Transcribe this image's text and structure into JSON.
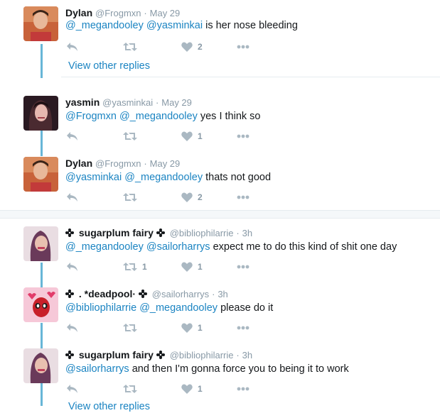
{
  "thread1": {
    "tweets": [
      {
        "name": "Dylan",
        "handle": "@Frogmxn",
        "dot": "·",
        "time": "May 29",
        "mentions": [
          "@_megandooley",
          "@yasminkai"
        ],
        "text": "is her nose bleeding",
        "likes": "2",
        "retweets": ""
      },
      {
        "name": "yasmin",
        "handle": "@yasminkai",
        "dot": "·",
        "time": "May 29",
        "mentions": [
          "@Frogmxn",
          "@_megandooley"
        ],
        "text": "yes I think so",
        "likes": "1",
        "retweets": ""
      },
      {
        "name": "Dylan",
        "handle": "@Frogmxn",
        "dot": "·",
        "time": "May 29",
        "mentions": [
          "@yasminkai",
          "@_megandooley"
        ],
        "text": "thats not good",
        "likes": "2",
        "retweets": ""
      }
    ],
    "view_other_replies": "View other replies"
  },
  "thread2": {
    "tweets": [
      {
        "name": "sugarplum fairy",
        "handle": "@bibliophilarrie",
        "dot": "·",
        "time": "3h",
        "mentions": [
          "@_megandooley",
          "@sailorharrys"
        ],
        "text": "expect me to do this kind of shit one day",
        "likes": "1",
        "retweets": "1"
      },
      {
        "name": ". *deadpool·",
        "handle": "@sailorharrys",
        "dot": "·",
        "time": "3h",
        "mentions": [
          "@bibliophilarrie",
          "@_megandooley"
        ],
        "text": "please do it",
        "likes": "1",
        "retweets": ""
      },
      {
        "name": "sugarplum fairy",
        "handle": "@bibliophilarrie",
        "dot": "·",
        "time": "3h",
        "mentions": [
          "@sailorharrys"
        ],
        "text": "and then I'm gonna force you to being it to work",
        "likes": "1",
        "retweets": ""
      }
    ],
    "view_other_replies": "View other replies"
  },
  "icons": {
    "reply": "reply-icon",
    "retweet": "retweet-icon",
    "like": "heart-icon",
    "more": "more-dots-icon",
    "badge": "flower-badge-icon"
  },
  "colors": {
    "mention": "#1b84c2",
    "thread_line": "#68b6d7",
    "action_gray": "#aab8c2",
    "divider": "#e6ecf0"
  }
}
